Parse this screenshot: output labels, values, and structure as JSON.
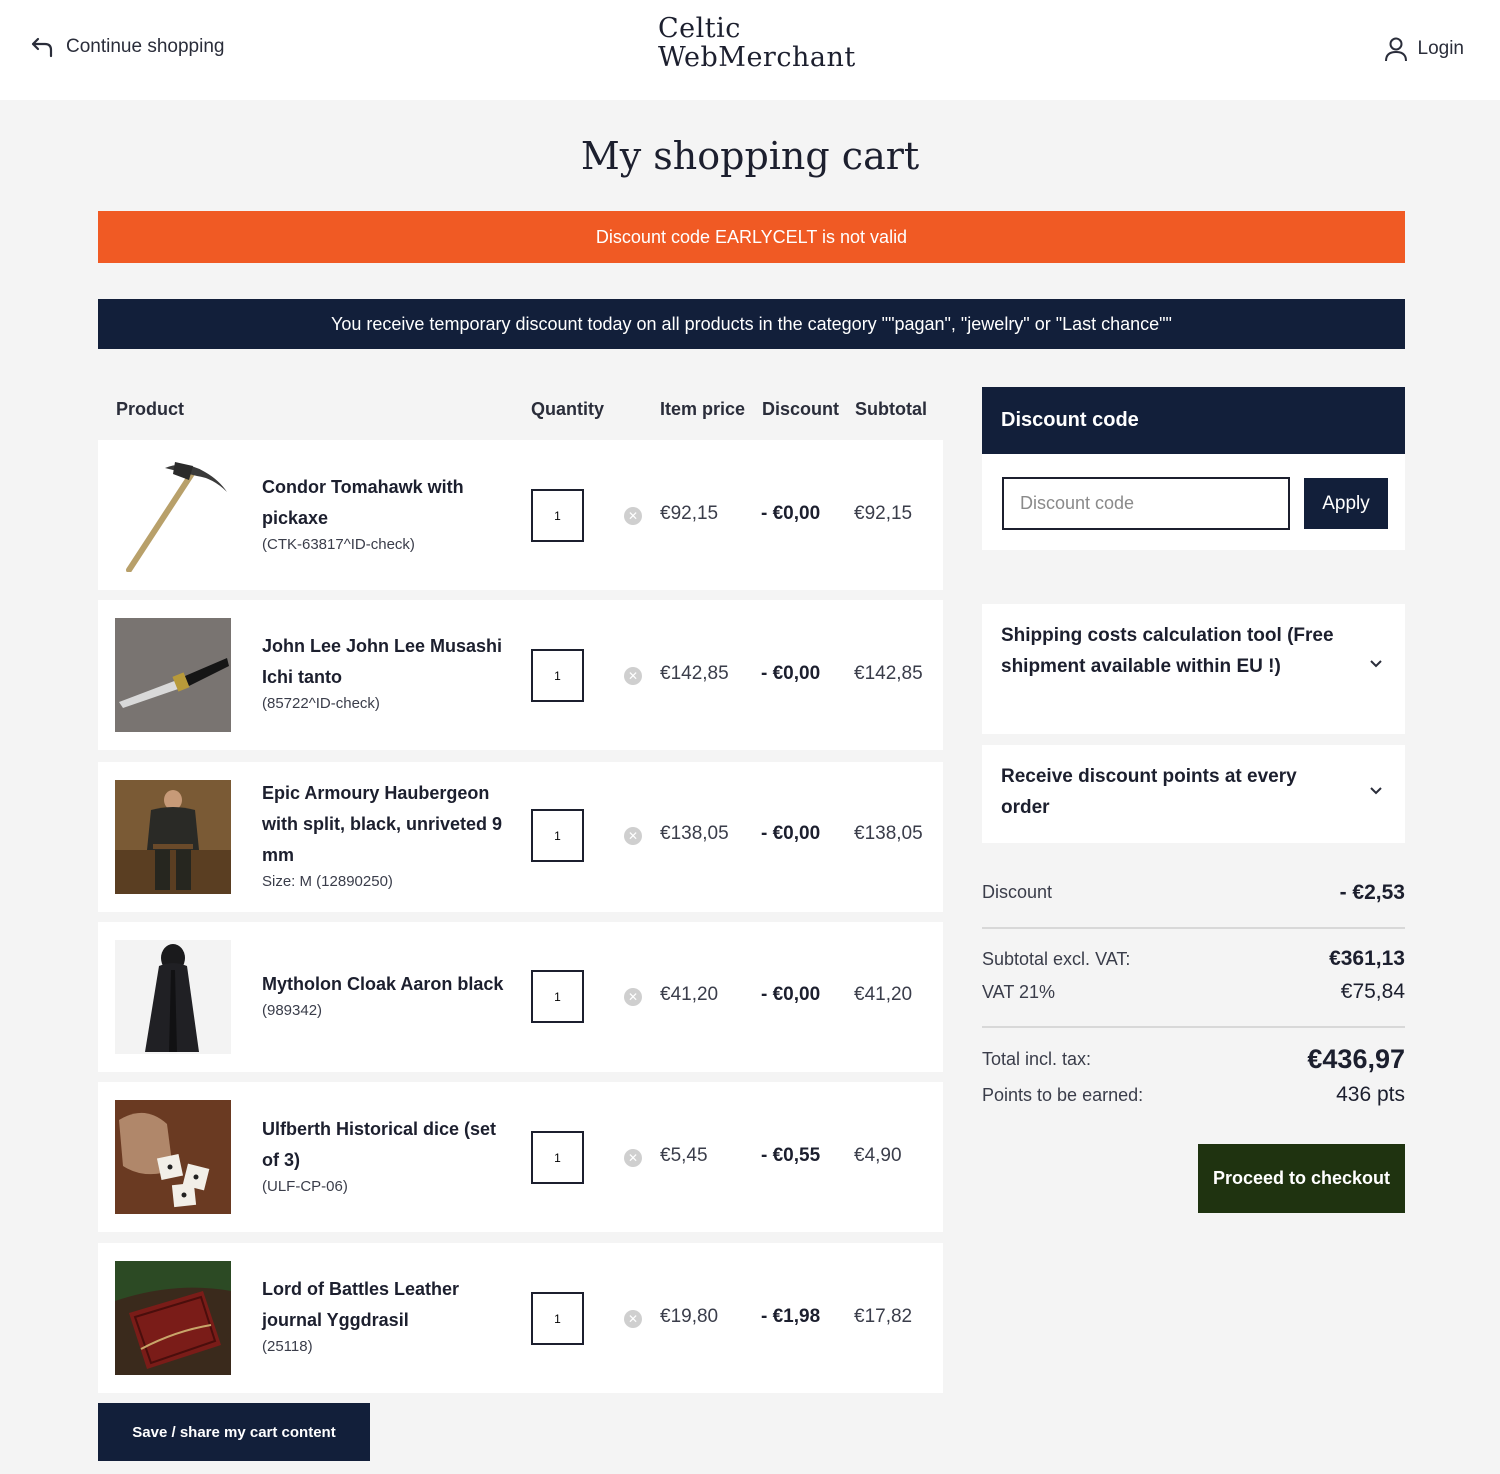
{
  "header": {
    "continue_label": "Continue shopping",
    "logo_line1": "Celtic",
    "logo_line2": "WebMerchant",
    "login_label": "Login"
  },
  "page_title": "My shopping cart",
  "alerts": {
    "error": "Discount code EARLYCELT is not valid",
    "info": "You receive temporary discount today on all products in the category \"\"pagan\", \"jewelry\" or \"Last chance\"\""
  },
  "columns": {
    "product": "Product",
    "quantity": "Quantity",
    "item_price": "Item price",
    "discount": "Discount",
    "subtotal": "Subtotal"
  },
  "items": [
    {
      "name": "Condor Tomahawk with pickaxe",
      "sku": "(CTK-63817^ID-check)",
      "qty": "1",
      "price": "€92,15",
      "discount": "- €0,00",
      "subtotal": "€92,15"
    },
    {
      "name": "John Lee John Lee Musashi Ichi tanto",
      "sku": "(85722^ID-check)",
      "qty": "1",
      "price": "€142,85",
      "discount": "- €0,00",
      "subtotal": "€142,85"
    },
    {
      "name": "Epic Armoury Haubergeon with split, black, unriveted 9 mm",
      "sku": "Size: M (12890250)",
      "qty": "1",
      "price": "€138,05",
      "discount": "- €0,00",
      "subtotal": "€138,05"
    },
    {
      "name": "Mytholon Cloak Aaron black",
      "sku": "(989342)",
      "qty": "1",
      "price": "€41,20",
      "discount": "- €0,00",
      "subtotal": "€41,20"
    },
    {
      "name": "Ulfberth Historical dice (set of 3)",
      "sku": "(ULF-CP-06)",
      "qty": "1",
      "price": "€5,45",
      "discount": "- €0,55",
      "subtotal": "€4,90"
    },
    {
      "name": "Lord of Battles Leather journal Yggdrasil",
      "sku": "(25118)",
      "qty": "1",
      "price": "€19,80",
      "discount": "- €1,98",
      "subtotal": "€17,82"
    }
  ],
  "save_cart_label": "Save / share my cart content",
  "discount_panel": {
    "title": "Discount code",
    "placeholder": "Discount code",
    "apply_label": "Apply"
  },
  "accordions": {
    "shipping": "Shipping costs calculation tool (Free shipment available within EU !)",
    "points": "Receive discount points at every order"
  },
  "summary": {
    "discount_label": "Discount",
    "discount_value": "- €2,53",
    "subtotal_label": "Subtotal excl. VAT:",
    "subtotal_value": "€361,13",
    "vat_label": "VAT 21%",
    "vat_value": "€75,84",
    "total_label": "Total incl. tax:",
    "total_value": "€436,97",
    "points_label": "Points to be earned:",
    "points_value": "436 pts"
  },
  "checkout_label": "Proceed to checkout",
  "colors": {
    "navy": "#121f3a",
    "orange": "#f05a24",
    "checkout_green": "#1f3310"
  }
}
